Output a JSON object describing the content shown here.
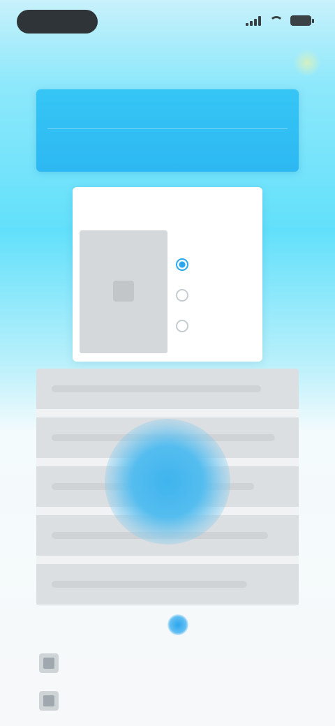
{
  "status_bar": {
    "time": "",
    "battery": ""
  },
  "nav": {
    "title": ""
  },
  "banner": {
    "line1": "",
    "line2": ""
  },
  "card": {
    "title": "",
    "options": [
      {
        "label": "",
        "selected": true
      },
      {
        "label": "",
        "selected": false
      },
      {
        "label": "",
        "selected": false
      }
    ]
  },
  "tags": {
    "left": "",
    "middle": "",
    "right": ""
  },
  "bullets": [
    {
      "text": ""
    },
    {
      "text": ""
    }
  ],
  "colors": {
    "accent": "#2db8f2",
    "card_bg": "#ffffff",
    "background_top": "#62e0fb"
  }
}
